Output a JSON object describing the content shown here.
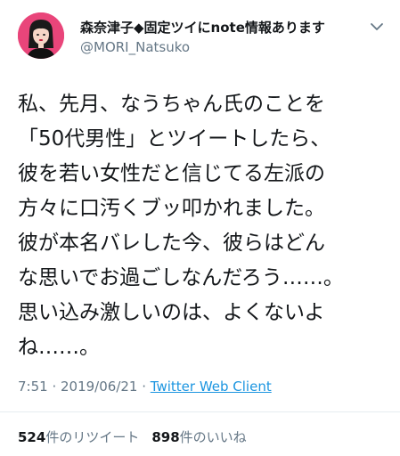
{
  "user": {
    "display_name": "森奈津子◆固定ツイにnote情報あります",
    "handle": "@MORI_Natsuko"
  },
  "tweet": {
    "lines": [
      "私、先月、なうちゃん氏のことを",
      "「50代男性」とツイートしたら、",
      "彼を若い女性だと信じてる左派の",
      "方々に口汚くブッ叩かれました。",
      "彼が本名バレした今、彼らはどん",
      "な思いでお過ごしなんだろう……。",
      "思い込み激しいのは、よくないよ",
      "ね……。"
    ],
    "time": "7:51",
    "separator": " · ",
    "date": "2019/06/21",
    "client": "Twitter Web Client"
  },
  "stats": {
    "retweets_count": "524",
    "retweets_label": "件のリツイート",
    "likes_count": "898",
    "likes_label": "件のいいね"
  },
  "icons": {
    "avatar": "avatar-illustration",
    "menu": "chevron-down-icon"
  },
  "colors": {
    "text": "#14171a",
    "secondary": "#657786",
    "link": "#1b95e0",
    "avatar_bg": "#e9457a"
  }
}
